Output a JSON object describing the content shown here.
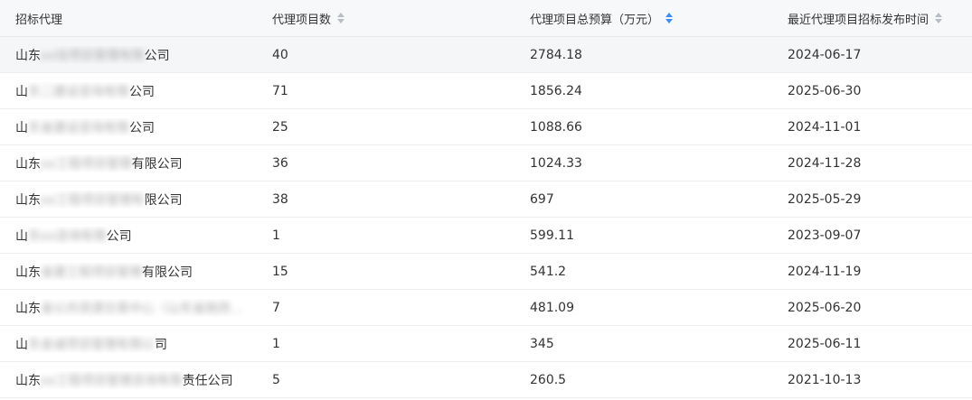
{
  "headers": {
    "agent": "招标代理",
    "count": "代理项目数",
    "budget": "代理项目总预算（万元）",
    "latest": "最近代理项目招标发布时间"
  },
  "rows": [
    {
      "prefix": "山东",
      "masked": "xx信项目管理有限",
      "suffix": "公司",
      "count": "40",
      "budget": "2784.18",
      "date": "2024-06-17"
    },
    {
      "prefix": "山",
      "masked": "东二建设咨询有限",
      "suffix": "公司",
      "count": "71",
      "budget": "1856.24",
      "date": "2025-06-30"
    },
    {
      "prefix": "山",
      "masked": "东省建设咨询有限",
      "suffix": "公司",
      "count": "25",
      "budget": "1088.66",
      "date": "2024-11-01"
    },
    {
      "prefix": "山东",
      "masked": "xx工程项目管理",
      "suffix": "有限公司",
      "count": "36",
      "budget": "1024.33",
      "date": "2024-11-28"
    },
    {
      "prefix": "山东",
      "masked": "xx工程项目管理有",
      "suffix": "限公司",
      "count": "38",
      "budget": "697",
      "date": "2025-05-29"
    },
    {
      "prefix": "山",
      "masked": "东xx咨询有限",
      "suffix": "公司",
      "count": "1",
      "budget": "599.11",
      "date": "2023-09-07"
    },
    {
      "prefix": "山东",
      "masked": "省建工程项目管理",
      "suffix": "有限公司",
      "count": "15",
      "budget": "541.2",
      "date": "2024-11-19"
    },
    {
      "prefix": "山东",
      "masked": "省公共资源交易中心（山东省政府...",
      "suffix": "",
      "count": "7",
      "budget": "481.09",
      "date": "2025-06-20"
    },
    {
      "prefix": "山",
      "masked": "东金诚项目管理有限公",
      "suffix": "司",
      "count": "1",
      "budget": "345",
      "date": "2025-06-11"
    },
    {
      "prefix": "山东",
      "masked": "xx工程项目管理咨询有限",
      "suffix": "责任公司",
      "count": "5",
      "budget": "260.5",
      "date": "2021-10-13"
    }
  ],
  "colors": {
    "sort_active": "#3b8cff",
    "sort_inactive": "#b8bcc4",
    "header_bg": "#f7f8fa",
    "row_highlight": "#f5f6f8"
  }
}
